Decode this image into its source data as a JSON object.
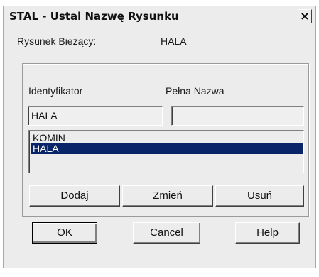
{
  "window": {
    "title": "STAL - Ustal Nazwę Rysunku",
    "close_glyph": "×"
  },
  "current": {
    "label": "Rysunek Bieżący:",
    "value": "HALA"
  },
  "fields": {
    "id_label": "Identyfikator",
    "name_label": "Pełna Nazwa",
    "id_value": "HALA",
    "name_value": ""
  },
  "list": {
    "items": [
      "KOMIN",
      "HALA"
    ],
    "selected": "HALA"
  },
  "buttons": {
    "add": "Dodaj",
    "change": "Zmień",
    "delete": "Usuń",
    "ok": "OK",
    "cancel": "Cancel",
    "help_mnemonic": "H",
    "help_rest": "elp"
  },
  "colors": {
    "selection": "#0a246a",
    "face": "#ececec"
  }
}
